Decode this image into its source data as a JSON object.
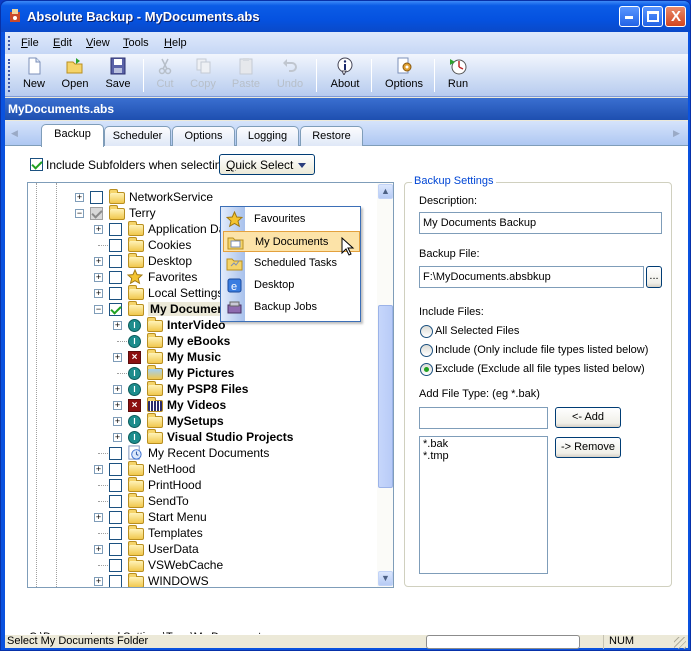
{
  "window": {
    "title": "Absolute Backup - MyDocuments.abs",
    "minimize_label": "_",
    "maximize_label": "□",
    "close_label": "X"
  },
  "menu": [
    {
      "label": "File",
      "accel": "F",
      "rest": "ile"
    },
    {
      "label": "Edit",
      "accel": "E",
      "rest": "dit"
    },
    {
      "label": "View",
      "accel": "V",
      "rest": "iew"
    },
    {
      "label": "Tools",
      "accel": "T",
      "rest": "ools"
    },
    {
      "label": "Help",
      "accel": "H",
      "rest": "elp"
    }
  ],
  "toolbar": [
    {
      "label": "New",
      "icon": "new-document-icon",
      "enabled": true
    },
    {
      "label": "Open",
      "icon": "open-folder-icon",
      "enabled": true
    },
    {
      "label": "Save",
      "icon": "floppy-disk-icon",
      "enabled": true
    },
    {
      "label": "Cut",
      "icon": "scissors-icon",
      "enabled": false
    },
    {
      "label": "Copy",
      "icon": "copy-icon",
      "enabled": false
    },
    {
      "label": "Paste",
      "icon": "paste-icon",
      "enabled": false
    },
    {
      "label": "Undo",
      "icon": "undo-icon",
      "enabled": false
    },
    {
      "label": "About",
      "icon": "info-icon",
      "enabled": true
    },
    {
      "label": "Options",
      "icon": "options-icon",
      "enabled": true
    },
    {
      "label": "Run",
      "icon": "run-icon",
      "enabled": true
    }
  ],
  "document_bar": {
    "title": "MyDocuments.abs"
  },
  "tabs": [
    {
      "label": "Backup",
      "active": true
    },
    {
      "label": "Scheduler",
      "active": false
    },
    {
      "label": "Options",
      "active": false
    },
    {
      "label": "Logging",
      "active": false
    },
    {
      "label": "Restore",
      "active": false
    }
  ],
  "backup": {
    "include_subfolders": {
      "label": "Include Subfolders when selecting:",
      "checked": true
    },
    "quick_select": {
      "accel": "Q",
      "rest": "uick Select"
    },
    "quick_select_menu": [
      {
        "label": "Favourites",
        "icon": "star-icon",
        "selected": false
      },
      {
        "label": "My Documents",
        "icon": "my-documents-icon",
        "selected": true
      },
      {
        "label": "Scheduled Tasks",
        "icon": "scheduled-tasks-icon",
        "selected": false
      },
      {
        "label": "Desktop",
        "icon": "desktop-icon",
        "selected": false
      },
      {
        "label": "Backup Jobs",
        "icon": "backup-jobs-icon",
        "selected": false
      }
    ],
    "tree": [
      {
        "label": "NetworkService",
        "level": 0,
        "expander": "+",
        "check": "off",
        "icon": "folder",
        "bold": false
      },
      {
        "label": "Terry",
        "level": 0,
        "expander": "-",
        "check": "gray",
        "icon": "folder",
        "bold": false
      },
      {
        "label": "Application Data",
        "level": 1,
        "expander": "+",
        "check": "off",
        "icon": "folder",
        "bold": false
      },
      {
        "label": "Cookies",
        "level": 1,
        "expander": "",
        "check": "off",
        "icon": "folder",
        "bold": false
      },
      {
        "label": "Desktop",
        "level": 1,
        "expander": "+",
        "check": "off",
        "icon": "folder",
        "bold": false
      },
      {
        "label": "Favorites",
        "level": 1,
        "expander": "+",
        "check": "off",
        "icon": "star",
        "bold": false
      },
      {
        "label": "Local Settings",
        "level": 1,
        "expander": "+",
        "check": "off",
        "icon": "folder",
        "bold": false
      },
      {
        "label": "My Documents",
        "level": 1,
        "expander": "-",
        "check": "on",
        "icon": "folder",
        "bold": true,
        "highlight": true
      },
      {
        "label": "InterVideo",
        "level": 2,
        "expander": "+",
        "check": "inherit",
        "icon": "folder",
        "bold": true
      },
      {
        "label": "My eBooks",
        "level": 2,
        "expander": "",
        "check": "inherit",
        "icon": "folder",
        "bold": true
      },
      {
        "label": "My Music",
        "level": 2,
        "expander": "+",
        "check": "excluded",
        "icon": "music-folder",
        "bold": true
      },
      {
        "label": "My Pictures",
        "level": 2,
        "expander": "",
        "check": "inherit",
        "icon": "pictures-folder",
        "bold": true
      },
      {
        "label": "My PSP8 Files",
        "level": 2,
        "expander": "+",
        "check": "inherit",
        "icon": "folder",
        "bold": true
      },
      {
        "label": "My Videos",
        "level": 2,
        "expander": "+",
        "check": "excluded",
        "icon": "videos-folder",
        "bold": true
      },
      {
        "label": "MySetups",
        "level": 2,
        "expander": "+",
        "check": "inherit",
        "icon": "folder",
        "bold": true
      },
      {
        "label": "Visual Studio Projects",
        "level": 2,
        "expander": "+",
        "check": "inherit",
        "icon": "folder",
        "bold": true
      },
      {
        "label": "My Recent Documents",
        "level": 1,
        "expander": "",
        "check": "off",
        "icon": "recent",
        "bold": false
      },
      {
        "label": "NetHood",
        "level": 1,
        "expander": "+",
        "check": "off",
        "icon": "folder",
        "bold": false
      },
      {
        "label": "PrintHood",
        "level": 1,
        "expander": "",
        "check": "off",
        "icon": "folder",
        "bold": false
      },
      {
        "label": "SendTo",
        "level": 1,
        "expander": "",
        "check": "off",
        "icon": "folder",
        "bold": false
      },
      {
        "label": "Start Menu",
        "level": 1,
        "expander": "+",
        "check": "off",
        "icon": "folder",
        "bold": false
      },
      {
        "label": "Templates",
        "level": 1,
        "expander": "",
        "check": "off",
        "icon": "folder",
        "bold": false
      },
      {
        "label": "UserData",
        "level": 1,
        "expander": "+",
        "check": "off",
        "icon": "folder",
        "bold": false
      },
      {
        "label": "VSWebCache",
        "level": 1,
        "expander": "",
        "check": "off",
        "icon": "folder",
        "bold": false
      },
      {
        "label": "WINDOWS",
        "level": 1,
        "expander": "+",
        "check": "off",
        "icon": "folder",
        "bold": false
      }
    ],
    "selected_path": "C:\\Documents and Settings\\Terry\\My Documents",
    "settings": {
      "group_title": "Backup Settings",
      "description_label": "Description:",
      "description_value": "My Documents Backup",
      "backup_file_label": "Backup File:",
      "backup_file_value": "F:\\MyDocuments.absbkup",
      "browse_label": "...",
      "include_files_label": "Include Files:",
      "radios": [
        {
          "label": "All Selected Files",
          "checked": false
        },
        {
          "label": "Include (Only include file types listed below)",
          "checked": false
        },
        {
          "label": "Exclude (Exclude all file types listed below)",
          "checked": true
        }
      ],
      "add_file_type_label": "Add File Type:  (eg  *.bak)",
      "add_file_type_value": "",
      "add_button": "<- Add",
      "remove_button": "-> Remove",
      "file_types": [
        "*.bak",
        "*.tmp"
      ]
    }
  },
  "statusbar": {
    "message": "Select My Documents Folder",
    "progress": "",
    "num": "NUM"
  }
}
